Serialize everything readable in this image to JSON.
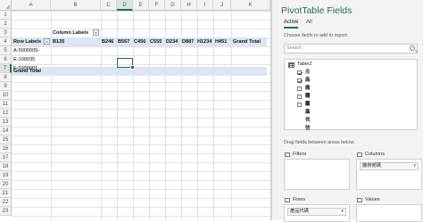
{
  "sheet": {
    "columns": [
      "A",
      "B",
      "C",
      "D",
      "E",
      "F",
      "G",
      "H",
      "I",
      "J",
      "K"
    ],
    "selected_column": "D",
    "rows": [
      "1",
      "2",
      "3",
      "4",
      "5",
      "6",
      "7",
      "8",
      "9",
      "10",
      "11",
      "12",
      "13",
      "14",
      "15",
      "16",
      "17",
      "18",
      "19",
      "20",
      "21",
      "22",
      "23"
    ],
    "selected_row": "7",
    "pivot": {
      "column_labels_caption": "Column Labels",
      "row_labels_caption": "Row Labels",
      "column_items": [
        "B135",
        "B246",
        "B567",
        "C456",
        "C555",
        "D234",
        "D887",
        "H1234",
        "H451"
      ],
      "grand_total_col": "Grand Total",
      "row_items": [
        "A-5000005-",
        "E-100035",
        "F-1000001"
      ],
      "grand_total_row": "Grand Total"
    }
  },
  "pane": {
    "title": "PivotTable Fields",
    "tabs": [
      {
        "label": "Active",
        "active": true
      },
      {
        "label": "All",
        "active": false
      }
    ],
    "hint": "Choose fields to add to report:",
    "search_placeholder": "Search",
    "table_name": "Table2",
    "fields": [
      {
        "label": "產品代碼",
        "checked": true
      },
      {
        "label": "廠商號碼",
        "checked": true
      },
      {
        "label": "廠商產品代號",
        "checked": false
      },
      {
        "label": "經銷商貨號",
        "checked": false
      },
      {
        "label": "成本",
        "checked": false
      }
    ],
    "drag_hint": "Drag fields between areas below:",
    "areas": {
      "filters": {
        "label": "Filters",
        "chips": []
      },
      "columns": {
        "label": "Columns",
        "chips": [
          "廠商號碼"
        ]
      },
      "rows": {
        "label": "Rows",
        "chips": [
          "產品代碼"
        ]
      },
      "values": {
        "label": "Values",
        "chips": []
      }
    },
    "accent_color": "#217346"
  }
}
